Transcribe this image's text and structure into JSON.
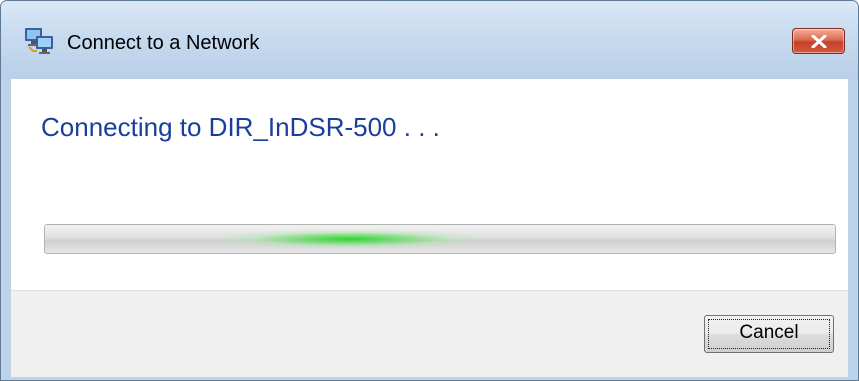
{
  "window": {
    "title": "Connect to a Network",
    "icon": "network-connection-icon",
    "close_icon": "close-icon"
  },
  "main": {
    "heading": "Connecting to DIR_InDSR-500 . . .",
    "progress": {
      "state": "indeterminate",
      "accent_color": "#2ed62e"
    }
  },
  "footer": {
    "cancel_label": "Cancel"
  },
  "colors": {
    "heading": "#1a3e9c",
    "titlebar": "#c7daef",
    "close_button": "#c4402a",
    "footer": "#f0f0f0"
  }
}
